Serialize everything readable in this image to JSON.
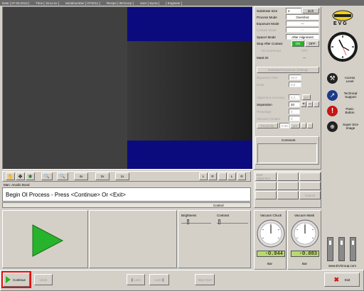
{
  "status_bar": [
    "Date [ 07.03.2013 ]",
    "Time [ 15:xx:xx ]",
    "Serialnumber [ 07/2011 ]",
    "Recipe [ 08-bcorp ]",
    "User [ Sysra ]",
    "[ Engineer ]"
  ],
  "brand": {
    "logo_text": "E V G",
    "footer": "www.EVGroup.com"
  },
  "right_buttons": [
    {
      "label": "Access Level",
      "icon": "wrench-icon"
    },
    {
      "label": "Technical Support",
      "icon": "support-icon"
    },
    {
      "label": "Panic Button",
      "icon": "panic-icon"
    },
    {
      "label": "Super Size Image",
      "icon": "magnify-icon"
    }
  ],
  "settings": {
    "substrate_size": {
      "label": "Substrate Size",
      "value": "4",
      "unit": "inch"
    },
    "process_mode": {
      "label": "Process Mode",
      "value": "Overshot"
    },
    "exposure_mode": {
      "label": "Exposure Mode",
      "value": "---"
    },
    "contact_mode": {
      "label": "Contact Mode",
      "value": "---"
    },
    "spacer_mode": {
      "label": "Spacer Mode",
      "value": "After Alignment"
    },
    "stop_after_contact": {
      "label": "Stop After Contact",
      "on": "ON",
      "off": "OFF"
    },
    "n2_overhead": {
      "label": "N2 Overhead",
      "value": "OFF"
    },
    "mask_id": {
      "label": "Mask ID",
      "value": "---"
    }
  },
  "exposure_settings": {
    "title": "Individual Exposure Settings",
    "exposure_time": {
      "label": "Exposure Time",
      "value": "30.0"
    },
    "dose": {
      "label": "Dose",
      "value": "0.0"
    },
    "alignment_accuracy": {
      "label": "Alignment Accuracy",
      "value": "4.4",
      "unit": "µm"
    },
    "separation": {
      "label": "Separation",
      "value": "20"
    },
    "prewedge": {
      "label": "Prewedge",
      "value": "0"
    },
    "vacuum_contact": {
      "label": "Vacuum Contact",
      "value": "0"
    },
    "proximity": {
      "label": "Proximity",
      "value": "0.00",
      "unit": "µm"
    },
    "comment_label": "Comment"
  },
  "toolbar": {
    "zoom_buttons": [
      "4x",
      "2x",
      "1x"
    ],
    "lr_buttons": [
      "L",
      "R",
      "L",
      "R"
    ]
  },
  "mode_label": "Man. Anodic Bond",
  "message": "Begin Ol Process - Press <Continue> Or <Exit>",
  "control_label": "Control",
  "side_panel": {
    "start_alignment": "Start Alignment",
    "cancel": "Cancel"
  },
  "sliders": {
    "brightness": "Brightness",
    "contrast": "Contrast"
  },
  "gauges": [
    {
      "title": "Vacuum Chuck",
      "value": "-0.044",
      "unit": "Bar"
    },
    {
      "title": "Vacuum Mask",
      "value": "-0.083",
      "unit": "Bar"
    }
  ],
  "bottom": {
    "continue": "Continue",
    "undo": "Undo",
    "left_lock": "Lock",
    "right_lock": "Lock",
    "step_over": "Step Over",
    "exit": "Exit"
  },
  "colors": {
    "accent_green": "#27b32b",
    "status_on": "#27b32b",
    "video_blue": "#0c0c7a",
    "gauge_lcd": "#b8d870",
    "exit_red": "#cc1818"
  }
}
